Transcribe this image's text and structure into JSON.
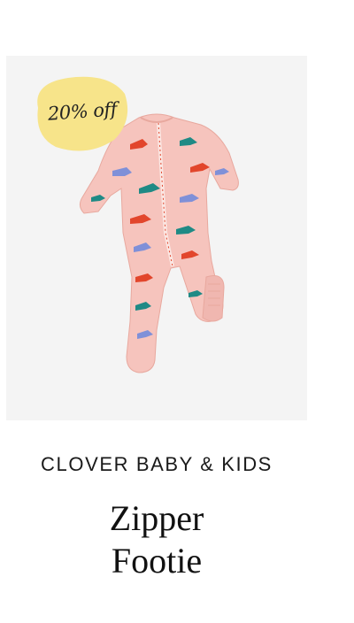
{
  "product": {
    "badge": "20% off",
    "brand": "CLOVER BABY & KIDS",
    "title_line1": "Zipper",
    "title_line2": "Footie",
    "image_alt": "Pink dinosaur print zipper footie",
    "image_icon": "zipper-footie-image"
  },
  "colors": {
    "badge_bg": "#f7e48a",
    "image_bg": "#f4f4f4",
    "fabric": "#f6c4bd",
    "dino_red": "#e2462c",
    "dino_teal": "#1f8a85",
    "dino_blue": "#7f90d8",
    "text": "#111111"
  }
}
